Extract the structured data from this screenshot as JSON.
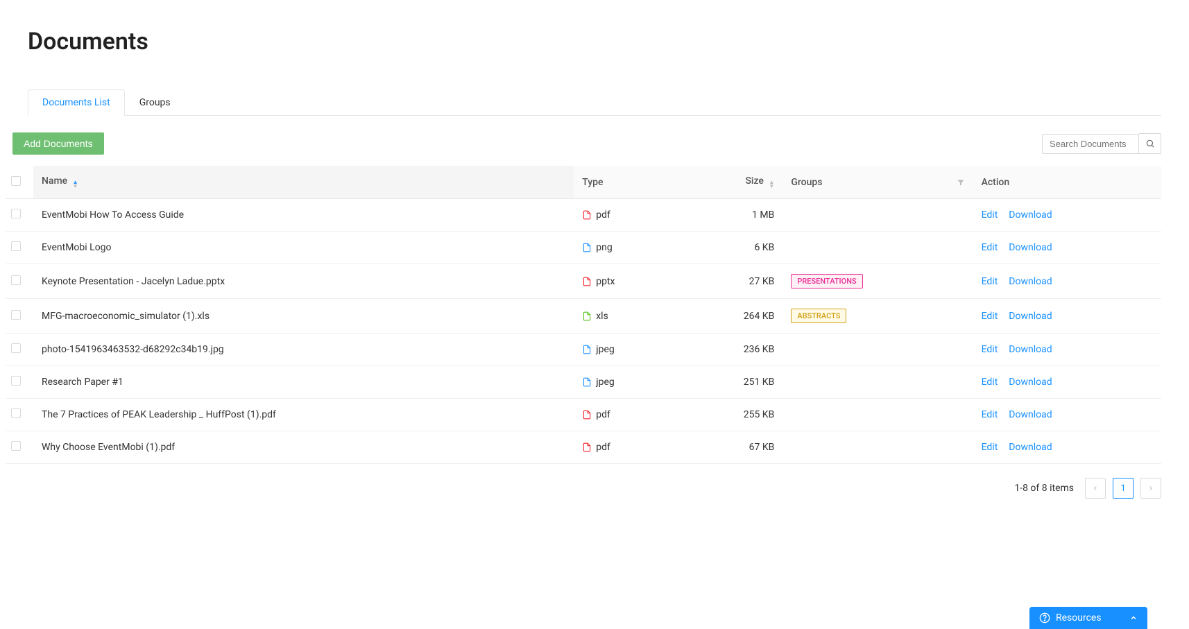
{
  "page": {
    "title": "Documents"
  },
  "tabs": [
    {
      "label": "Documents List",
      "active": true
    },
    {
      "label": "Groups",
      "active": false
    }
  ],
  "toolbar": {
    "add_button": "Add Documents"
  },
  "search": {
    "placeholder": "Search Documents"
  },
  "columns": {
    "name": "Name",
    "type": "Type",
    "size": "Size",
    "groups": "Groups",
    "action": "Action"
  },
  "rows": [
    {
      "name": "EventMobi How To Access Guide",
      "type": "pdf",
      "icon": "red",
      "size": "1 MB",
      "group": null,
      "group_color": null
    },
    {
      "name": "EventMobi Logo",
      "type": "png",
      "icon": "blue",
      "size": "6 KB",
      "group": null,
      "group_color": null
    },
    {
      "name": "Keynote Presentation - Jacelyn Ladue.pptx",
      "type": "pptx",
      "icon": "red",
      "size": "27 KB",
      "group": "PRESENTATIONS",
      "group_color": "pink"
    },
    {
      "name": "MFG-macroeconomic_simulator (1).xls",
      "type": "xls",
      "icon": "green",
      "size": "264 KB",
      "group": "ABSTRACTS",
      "group_color": "gold"
    },
    {
      "name": "photo-1541963463532-d68292c34b19.jpg",
      "type": "jpeg",
      "icon": "blue",
      "size": "236 KB",
      "group": null,
      "group_color": null
    },
    {
      "name": "Research Paper #1",
      "type": "jpeg",
      "icon": "blue",
      "size": "251 KB",
      "group": null,
      "group_color": null
    },
    {
      "name": "The 7 Practices of PEAK Leadership _ HuffPost (1).pdf",
      "type": "pdf",
      "icon": "red",
      "size": "255 KB",
      "group": null,
      "group_color": null
    },
    {
      "name": "Why Choose EventMobi (1).pdf",
      "type": "pdf",
      "icon": "red",
      "size": "67 KB",
      "group": null,
      "group_color": null
    }
  ],
  "actions": {
    "edit": "Edit",
    "download": "Download"
  },
  "pagination": {
    "info": "1-8 of 8 items",
    "current": "1"
  },
  "footer": {
    "resources": "Resources"
  }
}
